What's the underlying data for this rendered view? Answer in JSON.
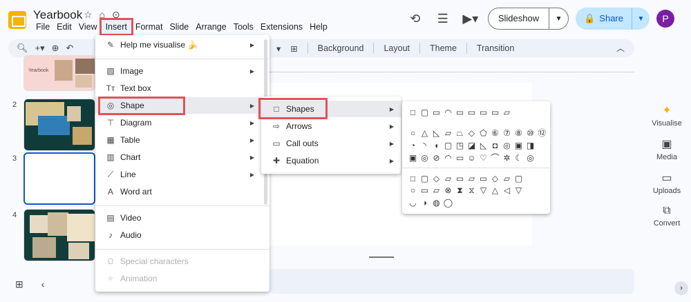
{
  "app": {
    "title": "Yearbook"
  },
  "menubar": [
    "File",
    "Edit",
    "View",
    "Insert",
    "Format",
    "Slide",
    "Arrange",
    "Tools",
    "Extensions",
    "Help"
  ],
  "header": {
    "slideshow_label": "Slideshow",
    "share_label": "Share",
    "avatar_letter": "P"
  },
  "toolbar": {
    "items": [
      "Background",
      "Layout",
      "Theme",
      "Transition"
    ]
  },
  "slides": {
    "numbers": [
      "2",
      "3",
      "4"
    ]
  },
  "thumb1_text": "Yearbook",
  "side_panel": [
    "Visualise",
    "Media",
    "Uploads",
    "Convert"
  ],
  "insert_menu": {
    "items": [
      {
        "label": "Help me visualise 🍌",
        "icon": "pencil-sparkle-icon"
      },
      {
        "label": "Image",
        "icon": "image-icon"
      },
      {
        "label": "Text box",
        "icon": "text-box-icon"
      },
      {
        "label": "Shape",
        "icon": "shape-icon"
      },
      {
        "label": "Diagram",
        "icon": "diagram-icon"
      },
      {
        "label": "Table",
        "icon": "table-icon"
      },
      {
        "label": "Chart",
        "icon": "chart-icon"
      },
      {
        "label": "Line",
        "icon": "line-icon"
      },
      {
        "label": "Word art",
        "icon": "word-art-icon"
      },
      {
        "label": "Video",
        "icon": "video-icon"
      },
      {
        "label": "Audio",
        "icon": "audio-icon"
      },
      {
        "label": "Special characters",
        "icon": "omega-icon"
      },
      {
        "label": "Animation",
        "icon": "animation-icon"
      }
    ]
  },
  "shape_submenu": {
    "items": [
      {
        "label": "Shapes",
        "icon": "square-icon"
      },
      {
        "label": "Arrows",
        "icon": "arrow-icon"
      },
      {
        "label": "Call outs",
        "icon": "callout-icon"
      },
      {
        "label": "Equation",
        "icon": "plus-icon"
      }
    ]
  },
  "shapes_palette": {
    "rows": [
      "□▢▭◠▭▭▭▭▱",
      "○△◺▱⏢◇⬠⑥⑦⑧⑩⑫",
      "◔◝◖▢◳◪◺◘◎▣◨",
      "▣◎⊘◠▭☺♡⌒✲☾◎",
      "□▢◇▱▭▱▭◇▱▢",
      "○▭▱⊗⧗⧖▽△◁▽",
      "◡◑◍◯"
    ]
  },
  "colors": {
    "accent": "#0b57d0",
    "highlight_box": "#e0525a",
    "share_bg": "#c2e7ff"
  }
}
